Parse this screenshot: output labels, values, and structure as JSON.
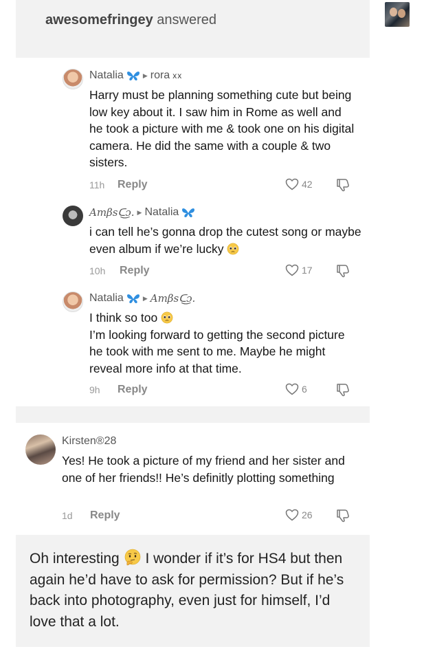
{
  "post": {
    "asker": "awesomefringey",
    "verb": "answered",
    "avatar_icon": "blog-avatar-photo"
  },
  "comments": [
    {
      "author": "Natalia",
      "badge_icon": "blue-butterfly-icon",
      "reply_to": "rora",
      "reply_to_suffix": "xx",
      "text": "Harry must be planning something cute but being low key about it. I saw him in Rome as well and he took a picture with me & took one on his digital camera. He did the same with a couple & two sisters.",
      "time": "11h",
      "reply_label": "Reply",
      "likes": "42"
    },
    {
      "author": "Amβsᑕ͜ɔ.",
      "reply_to": "Natalia",
      "badge_icon": "blue-butterfly-icon",
      "text": "i can tell he’s gonna drop the cutest song or maybe even album if we’re lucky",
      "emoji": "pleading-face",
      "time": "10h",
      "reply_label": "Reply",
      "likes": "17"
    },
    {
      "author": "Natalia",
      "badge_icon": "blue-butterfly-icon",
      "reply_to": "Amβsᑕ͜ɔ.",
      "line1": "I think so too",
      "emoji": "pleading-face",
      "text": "I’m looking forward to getting the second picture he took with me sent to me. Maybe he might reveal more info at that time.",
      "time": "9h",
      "reply_label": "Reply",
      "likes": "6"
    },
    {
      "author": "Kirsten®28",
      "text": "Yes! He took a picture of my friend and her sister and one of her friends!! He’s definitly plotting something",
      "time": "1d",
      "reply_label": "Reply",
      "likes": "26"
    }
  ],
  "answer": {
    "text_before_emoji": "Oh interesting",
    "emoji": "thinking-face",
    "text_after_emoji": "I wonder if it’s for HS4 but then again he’d have to ask for permission? But if he’s back into photography, even just for himself, I’d love that a lot."
  },
  "colors": {
    "card_bg": "#f2f2f2",
    "butterfly": "#2f8fe0",
    "emoji_yellow": "#f7c948"
  }
}
